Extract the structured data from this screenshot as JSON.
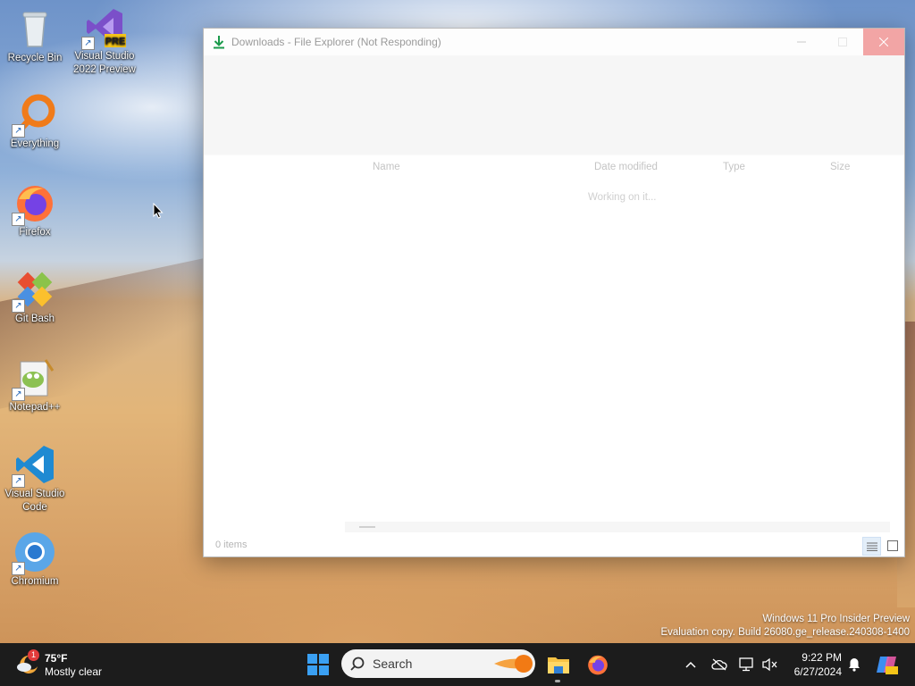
{
  "desktop": {
    "icons": [
      {
        "label": "Recycle Bin"
      },
      {
        "label": "Visual Studio 2022 Preview",
        "badge": "PRE"
      },
      {
        "label": "Everything"
      },
      {
        "label": "Firefox"
      },
      {
        "label": "Git Bash"
      },
      {
        "label": "Notepad++"
      },
      {
        "label": "Visual Studio Code"
      },
      {
        "label": "Chromium"
      }
    ]
  },
  "window": {
    "title": "Downloads - File Explorer (Not Responding)",
    "columns": [
      "Name",
      "Date modified",
      "Type",
      "Size"
    ],
    "loading_text": "Working on it...",
    "status_count": "0 items"
  },
  "watermark": {
    "line1": "Windows 11 Pro Insider Preview",
    "line2": "Evaluation copy. Build 26080.ge_release.240308-1400"
  },
  "taskbar": {
    "weather": {
      "temp": "75°F",
      "condition": "Mostly clear",
      "badge": "1"
    },
    "search_placeholder": "Search",
    "clock": {
      "time": "9:22 PM",
      "date": "6/27/2024"
    }
  },
  "colors": {
    "taskbar_bg": "#1c1c1c",
    "close_hover": "#f2a5a5",
    "accent": "#0078d4"
  }
}
